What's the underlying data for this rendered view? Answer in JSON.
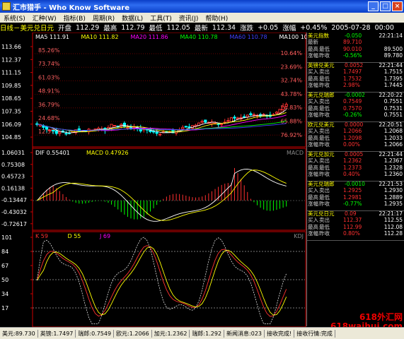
{
  "window": {
    "title": "汇市猎手 - Who Know Software",
    "min": "_",
    "max": "□",
    "close": "×"
  },
  "menu": [
    "系统(S)",
    "汇种(W)",
    "指标(B)",
    "周期(R)",
    "数据(L)",
    "工具(T)",
    "资讯(J)",
    "帮助(H)"
  ],
  "info": {
    "symbol": "日线－美元兑日元",
    "open_label": "开盘",
    "open": "112.29",
    "high_label": "最高",
    "high": "112.79",
    "low_label": "最低",
    "low": "112.05",
    "close_label": "最新",
    "close": "112.34",
    "change_label": "涨跌",
    "change": "+0.05",
    "pct_label": "涨幅",
    "pct": "+0.45%",
    "date": "2005-07-28",
    "time": "00:00"
  },
  "main_panel": {
    "ma_labels": [
      {
        "text": "MA5  111.91",
        "color": "#ffffff"
      },
      {
        "text": "MA10  111.82",
        "color": "#ffff00"
      },
      {
        "text": "MA20  111.86",
        "color": "#ff00ff"
      },
      {
        "text": "MA40  110.78",
        "color": "#00ff00"
      },
      {
        "text": "MA60  110.78",
        "color": "#4040ff"
      },
      {
        "text": "MA100 108.78",
        "color": "#ffffff"
      }
    ],
    "yticks": [
      "113.66",
      "112.37",
      "111.15",
      "109.85",
      "108.65",
      "107.35",
      "106.09",
      "104.85"
    ],
    "fib_left": [
      "85.26%",
      "73.74%",
      "61.03%",
      "48.91%",
      "36.79%",
      "24.68%",
      "12.57%"
    ],
    "fib_right": [
      "10.64%",
      "23.69%",
      "32.74%",
      "43.78%",
      "54.83%",
      "65.88%",
      "76.92%"
    ]
  },
  "macd_panel": {
    "labels": [
      {
        "text": "DIF  0.55401",
        "color": "#ffffff"
      },
      {
        "text": "MACD  0.47926",
        "color": "#ffff00"
      }
    ],
    "title": "MACD",
    "yticks": [
      "1.06031",
      "0.75308",
      "0.45723",
      "0.16138",
      "-0.13447",
      "-0.43032",
      "-0.72617"
    ]
  },
  "kdj_panel": {
    "labels": [
      {
        "text": "K  59",
        "color": "#ff3030"
      },
      {
        "text": "D  55",
        "color": "#ffff00"
      },
      {
        "text": "J  69",
        "color": "#ff00ff"
      }
    ],
    "title": "KDJ",
    "yticks": [
      "101",
      "84",
      "67",
      "50",
      "34",
      "17"
    ]
  },
  "quotes": [
    {
      "name": "美元指数",
      "chg": "-0.050",
      "time": "22:21:14",
      "rows": [
        [
          "最新",
          "",
          "89.710",
          ""
        ],
        [
          "最高",
          "最低",
          "90.010",
          "89.500"
        ],
        [
          "涨幅",
          "昨收",
          "-0.56%",
          "89.780"
        ]
      ]
    },
    {
      "name": "英镑兑美元",
      "chg": "0.0052",
      "time": "22:21:44",
      "rows": [
        [
          "买入",
          "卖出",
          "1.7497",
          "1.7515"
        ],
        [
          "最高",
          "最低",
          "1.7532",
          "1.7395"
        ],
        [
          "涨幅",
          "昨收",
          "2.98%",
          "1.7445"
        ]
      ]
    },
    {
      "name": "美元兑瑞郎",
      "chg": "-0.0002",
      "time": "22:20:22",
      "rows": [
        [
          "买入",
          "卖出",
          "0.7549",
          "0.7551"
        ],
        [
          "最高",
          "最低",
          "0.7570",
          "0.7531"
        ],
        [
          "涨幅",
          "昨收",
          "-0.26%",
          "0.7551"
        ]
      ]
    },
    {
      "name": "欧元兑美元",
      "chg": "0.0000",
      "time": "22:20:51",
      "rows": [
        [
          "买入",
          "卖出",
          "1.2066",
          "1.2068"
        ],
        [
          "最高",
          "最低",
          "1.2098",
          "1.2033"
        ],
        [
          "涨幅",
          "昨收",
          "0.00%",
          "1.2066"
        ]
      ]
    },
    {
      "name": "美元兑加元",
      "chg": "0.0005",
      "time": "22:21:44",
      "rows": [
        [
          "买入",
          "卖出",
          "1.2362",
          "1.2367"
        ],
        [
          "最高",
          "最低",
          "1.2373",
          "1.2328"
        ],
        [
          "涨幅",
          "昨收",
          "0.40%",
          "1.2360"
        ]
      ]
    },
    {
      "name": "美元兑瑞郎",
      "chg": "-0.0010",
      "time": "22:21:53",
      "rows": [
        [
          "买入",
          "卖出",
          "1.2925",
          "1.2930"
        ],
        [
          "最高",
          "最低",
          "1.2981",
          "1.2889"
        ],
        [
          "涨幅",
          "昨收",
          "-0.77%",
          "1.2935"
        ]
      ]
    },
    {
      "name": "美元兑日元",
      "chg": "0.09",
      "time": "22:21:17",
      "rows": [
        [
          "买入",
          "卖出",
          "112.37",
          "112.55"
        ],
        [
          "最高",
          "最低",
          "112.99",
          "112.08"
        ],
        [
          "涨幅",
          "昨收",
          "0.80%",
          "112.28"
        ]
      ]
    }
  ],
  "status": [
    "美元:89.730",
    "英镑:1.7497",
    "瑞郎:0.7549",
    "欧元:1.2066",
    "加元:1.2362",
    "瑞郎:1.292",
    "新闻消息:023",
    "接收完成!",
    "接收行情:完成"
  ],
  "watermark": {
    "line1": "618外汇网",
    "line2": "618waihui.com"
  }
}
